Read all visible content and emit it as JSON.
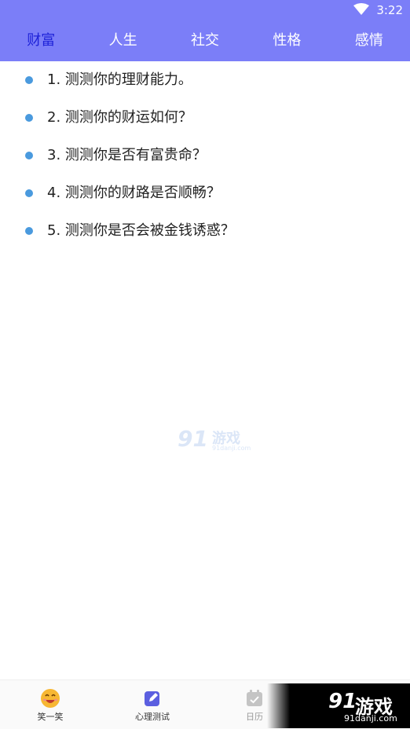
{
  "status_bar": {
    "time": "3:22",
    "icon": "wifi-icon"
  },
  "tabs": [
    {
      "label": "财富",
      "active": true
    },
    {
      "label": "人生",
      "active": false
    },
    {
      "label": "社交",
      "active": false
    },
    {
      "label": "性格",
      "active": false
    },
    {
      "label": "感情",
      "active": false
    }
  ],
  "list": [
    "1. 测测你的理财能力。",
    "2. 测测你的财运如何？",
    "3. 测测你是否有富贵命？",
    "4. 测测你的财路是否顺畅？",
    "5. 测测你是否会被金钱诱惑？"
  ],
  "watermark": {
    "num": "91",
    "text": "游戏",
    "url": "91danji.com"
  },
  "bottom_nav": [
    {
      "label": "笑一笑",
      "icon": "smiley-icon"
    },
    {
      "label": "心理测试",
      "icon": "edit-icon"
    },
    {
      "label": "日历",
      "icon": "calendar-icon"
    }
  ],
  "logo": {
    "num": "91",
    "text": "游戏",
    "url": "91danji.com"
  },
  "colors": {
    "header": "#7b7ef8",
    "active_tab": "#1e22d8",
    "bullet": "#4a9ade"
  }
}
